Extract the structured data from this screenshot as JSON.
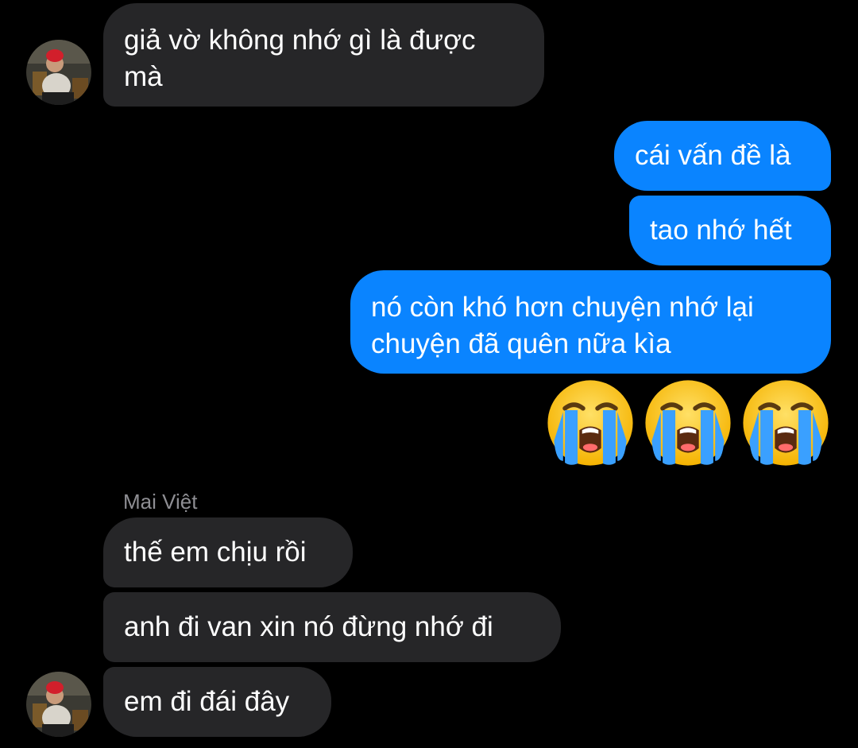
{
  "conversation": {
    "messages": [
      {
        "direction": "incoming",
        "text": "giả vờ không nhớ gì là được mà"
      },
      {
        "direction": "outgoing",
        "text": "cái vấn đề là"
      },
      {
        "direction": "outgoing",
        "text": "tao nhớ hết"
      },
      {
        "direction": "outgoing",
        "text": "nó còn khó hơn chuyện nhớ lại chuyện đã quên nữa kìa"
      },
      {
        "direction": "outgoing",
        "type": "emoji",
        "emoji": [
          "loudly-crying-face-icon",
          "loudly-crying-face-icon",
          "loudly-crying-face-icon"
        ]
      },
      {
        "direction": "incoming",
        "text": "thế em chịu rồi"
      },
      {
        "direction": "incoming",
        "text": "anh đi van xin nó đừng nhớ đi"
      },
      {
        "direction": "incoming",
        "text": "em đi đái đây"
      }
    ],
    "sender_name": "Mai Việt"
  },
  "colors": {
    "background": "#000000",
    "incoming_bubble": "#262628",
    "outgoing_bubble": "#0a84ff",
    "sender_name": "#8e8e93"
  }
}
